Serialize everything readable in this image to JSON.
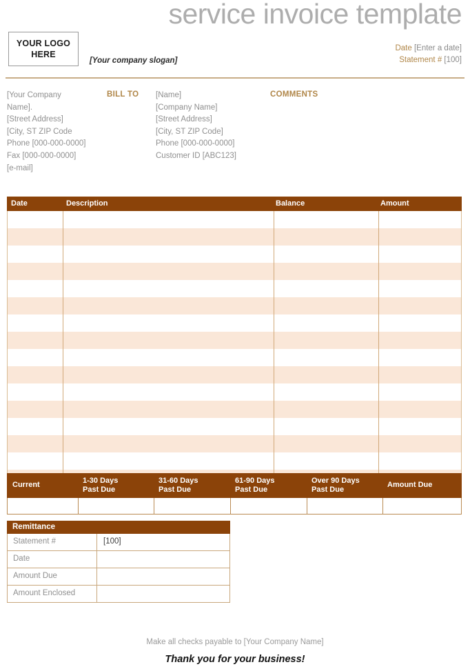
{
  "document": {
    "title": "service invoice template"
  },
  "logo": {
    "line1": "YOUR LOGO",
    "line2": "HERE",
    "slogan": "[Your company slogan]"
  },
  "meta": {
    "date_label": "Date",
    "date_value": "[Enter a date]",
    "statement_label": "Statement #",
    "statement_value": "[100]"
  },
  "from_address": {
    "lines": [
      "[Your Company",
      "Name].",
      "[Street Address]",
      "[City, ST  ZIP Code",
      "Phone [000-000-0000]",
      "Fax [000-000-0000]",
      "[e-mail]"
    ]
  },
  "bill_to": {
    "label": "BILL TO",
    "lines": [
      "[Name]",
      "[Company Name]",
      "[Street Address]",
      "[City, ST  ZIP Code]",
      "Phone [000-000-0000]",
      "Customer ID [ABC123]"
    ]
  },
  "comments": {
    "label": "COMMENTS"
  },
  "line_items_table": {
    "columns": [
      "Date",
      "Description",
      "Balance",
      "Amount"
    ],
    "row_count": 16,
    "rows": []
  },
  "aging_summary": {
    "columns": [
      {
        "line1": "Current",
        "line2": ""
      },
      {
        "line1": "1-30 Days",
        "line2": "Past Due"
      },
      {
        "line1": "31-60 Days",
        "line2": "Past Due"
      },
      {
        "line1": "61-90 Days",
        "line2": "Past Due"
      },
      {
        "line1": "Over 90 Days",
        "line2": "Past Due"
      },
      {
        "line1": "Amount Due",
        "line2": ""
      }
    ],
    "values": [
      "",
      "",
      "",
      "",
      "",
      ""
    ]
  },
  "remittance": {
    "title": "Remittance",
    "rows": [
      {
        "label": "Statement #",
        "value": "[100]"
      },
      {
        "label": "Date",
        "value": ""
      },
      {
        "label": "Amount Due",
        "value": ""
      },
      {
        "label": "Amount Enclosed",
        "value": ""
      }
    ]
  },
  "footer": {
    "note": "Make all checks payable to [Your Company Name]",
    "thanks": "Thank you for your business!"
  },
  "colors": {
    "brand_brown": "#8B4309",
    "stripe_peach": "#FAE7D8",
    "label_tan": "#B08648",
    "title_gray": "#ADADAD",
    "border_tan": "#C9A77C"
  }
}
